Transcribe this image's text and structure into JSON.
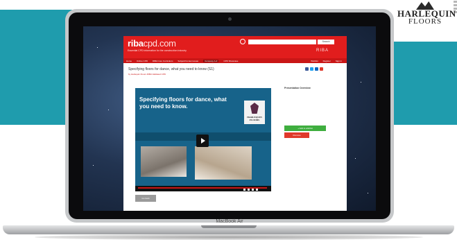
{
  "brand_corner": {
    "logo_word": "HARLEQUIN",
    "logo_sub": "FLOORS"
  },
  "laptop": {
    "model_label": "MacBook Air"
  },
  "site": {
    "logo_main": "riba",
    "logo_accent": "cpd.com",
    "tagline": "Essential CPD information for the construction industry",
    "search": {
      "placeholder": "",
      "button_label": "Search"
    },
    "riba_mark": "RIBA",
    "nav": {
      "items": [
        "Home",
        "Online CPD",
        "RIBA Core Curriculum",
        "Subject/Content areas",
        "Company A-Z",
        "CPD Showcase"
      ],
      "active_index": 4,
      "right_items": [
        "Wishlist",
        "Register",
        "Sign in"
      ]
    },
    "page_title": "Specifying floors for dance, what you need to know (S1)",
    "author": "by Harlequin Floors RIBA Validated CPD",
    "video": {
      "title": "Specifying floors for dance, what you need to know.",
      "brand_text": "HARLEQUIN FLOORS"
    },
    "sidebar": {
      "heading": "Presentation Overview"
    },
    "buttons": {
      "add_label": "+ Add to wishlist",
      "remove_label": "Remove",
      "back_label": "Go back"
    }
  },
  "colors": {
    "teal_band": "#1f9cad",
    "site_red": "#e11d1d",
    "video_blue": "#17638a",
    "green_button": "#3fae3f"
  }
}
